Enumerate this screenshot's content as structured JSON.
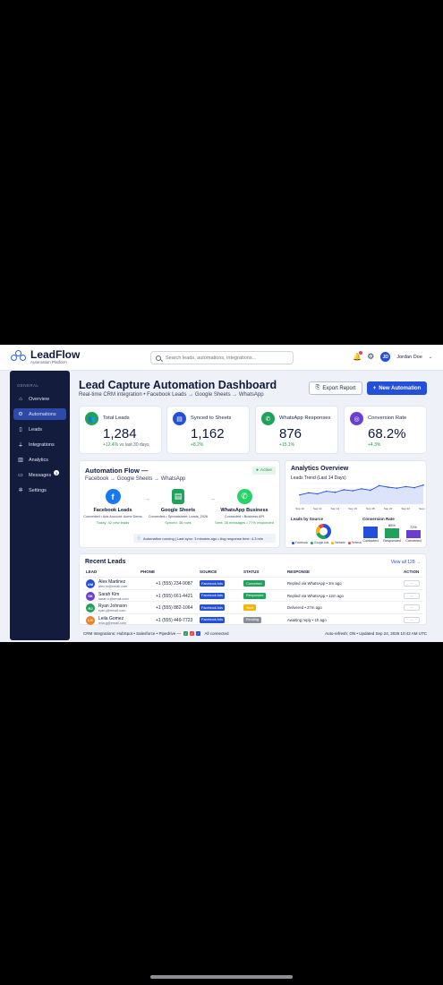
{
  "app": {
    "name": "LeadFlow",
    "tagline": "Automation Platform"
  },
  "search": {
    "placeholder": "Search leads, automations, integrations..."
  },
  "user": {
    "initials": "JD",
    "name": "Jordan Doe"
  },
  "sidebar": {
    "section": "GENERAL",
    "items": [
      {
        "label": "Overview",
        "icon": "home-icon"
      },
      {
        "label": "Automations",
        "icon": "gear-icon",
        "active": true
      },
      {
        "label": "Leads",
        "icon": "document-icon"
      },
      {
        "label": "Integrations",
        "icon": "plug-icon"
      },
      {
        "label": "Analytics",
        "icon": "chart-icon"
      },
      {
        "label": "Messages",
        "icon": "message-icon",
        "badge": "3"
      },
      {
        "label": "Settings",
        "icon": "settings-icon"
      }
    ]
  },
  "header": {
    "title": "Lead Capture Automation Dashboard",
    "subtitle": "Real-time CRM integration • Facebook Leads → Google Sheets → WhatsApp",
    "export_label": "Export Report",
    "new_label": "New Automation"
  },
  "stats": [
    {
      "label": "Total Leads",
      "value": "1,284",
      "delta": "+12.4%",
      "note": "vs last 30 days",
      "color": "#1fa25a"
    },
    {
      "label": "Synced to Sheets",
      "value": "1,162",
      "delta": "+8.2%",
      "note": "",
      "color": "#2350d9"
    },
    {
      "label": "WhatsApp Responses",
      "value": "876",
      "delta": "+15.1%",
      "note": "",
      "color": "#1fa25a"
    },
    {
      "label": "Conversion Rate",
      "value": "68.2%",
      "delta": "+4.3%",
      "note": "",
      "color": "#6a3fd0"
    }
  ],
  "flow": {
    "title": "Automation Flow —",
    "subtitle": "Facebook → Google Sheets → WhatsApp",
    "status": "Active",
    "nodes": [
      {
        "name": "Facebook Leads",
        "desc": "Connected • Ads Account: Acme Demo",
        "stat": "Today: 42 new leads",
        "color": "#1877f2",
        "glyph": "f"
      },
      {
        "name": "Google Sheets",
        "desc": "Connected • Spreadsheet: Leads_2026",
        "stat": "Synced: 38 rows",
        "color": "#1fa25a",
        "glyph": "▤"
      },
      {
        "name": "WhatsApp Business",
        "desc": "Connected • Business API",
        "stat": "Sent: 36 messages • 77% responded",
        "color": "#25d366",
        "glyph": "✆"
      }
    ],
    "footer": "Automation running | Last sync: 3 minutes ago • Avg response time: 4.3 min"
  },
  "analytics": {
    "title": "Analytics Overview",
    "trend_title": "Leads Trend (Last 14 Days)",
    "sources_title": "Leads by Source",
    "conversion_title": "Conversion Rate",
    "legend": [
      "Facebook",
      "Google Ads",
      "Website",
      "Referral"
    ],
    "legend_colors": [
      "#2350d9",
      "#1fa25a",
      "#f5b400",
      "#e5484d"
    ]
  },
  "chart_data": [
    {
      "type": "line",
      "title": "Leads Trend (Last 14 Days)",
      "x": [
        "Sep 10",
        "Sep 11",
        "Sep 12",
        "Sep 13",
        "Sep 14",
        "Sep 15",
        "Sep 16",
        "Sep 17",
        "Sep 18",
        "Sep 19",
        "Sep 20",
        "Sep 21",
        "Sep 22",
        "Sep 23",
        "Sep 24"
      ],
      "x_tick_labels": [
        "Sep 10",
        "Sep 12",
        "Sep 14",
        "Sep 16",
        "Sep 18",
        "Sep 20",
        "Sep 22",
        "Sep 24"
      ],
      "y": [
        18,
        22,
        20,
        25,
        23,
        28,
        26,
        30,
        27,
        36,
        33,
        31,
        34,
        32,
        37
      ],
      "ylim": [
        0,
        40
      ],
      "grid": true
    },
    {
      "type": "bar",
      "title": "Conversion Rate",
      "categories": [
        "Contacted",
        "Responded",
        "Converted"
      ],
      "values": [
        100,
        85,
        72
      ],
      "data_labels": [
        "",
        "85%",
        "72%"
      ],
      "colors": [
        "#2350d9",
        "#1fa25a",
        "#6a3fd0"
      ],
      "ylim": [
        0,
        100
      ]
    }
  ],
  "leads": {
    "title": "Recent Leads",
    "view_all": "View all 128 →",
    "headers": [
      "LEAD",
      "PHONE",
      "SOURCE",
      "STATUS",
      "RESPONSE",
      "ACTION"
    ],
    "rows": [
      {
        "initials": "AM",
        "name": "Alex Martinez",
        "email": "alex.m@email.com",
        "phone": "+1 (555) 234-9087",
        "source": "Facebook Ads",
        "status": "Converted",
        "status_color": "#1fa25a",
        "response": "Replied via WhatsApp • 3m ago",
        "avatar_color": "#2350d9"
      },
      {
        "initials": "SK",
        "name": "Sarah Kim",
        "email": "sarah.k@email.com",
        "phone": "+1 (555) 661-4421",
        "source": "Facebook Ads",
        "status": "Responded",
        "status_color": "#1fa25a",
        "response": "Replied via WhatsApp • 12m ago",
        "avatar_color": "#6a3fd0"
      },
      {
        "initials": "RJ",
        "name": "Ryan Johnson",
        "email": "ryan.j@email.com",
        "phone": "+1 (555) 882-1064",
        "source": "Facebook Ads",
        "status": "Sent",
        "status_color": "#f5b400",
        "response": "Delivered • 27m ago",
        "avatar_color": "#1fa25a"
      },
      {
        "initials": "LG",
        "name": "Leila Gomez",
        "email": "leila.g@email.com",
        "phone": "+1 (555) 449-7723",
        "source": "Facebook Ads",
        "status": "Pending",
        "status_color": "#8a8f9c",
        "response": "Awaiting reply • 1h ago",
        "avatar_color": "#e8842a"
      }
    ],
    "action_label": "···"
  },
  "footer": {
    "left": "CRM Integrations: HubSpot • Salesforce • Pipedrive —",
    "connected": "All connected",
    "right": "Auto-refresh: ON • Updated Sep 24, 2026 10:42 AM UTC"
  }
}
